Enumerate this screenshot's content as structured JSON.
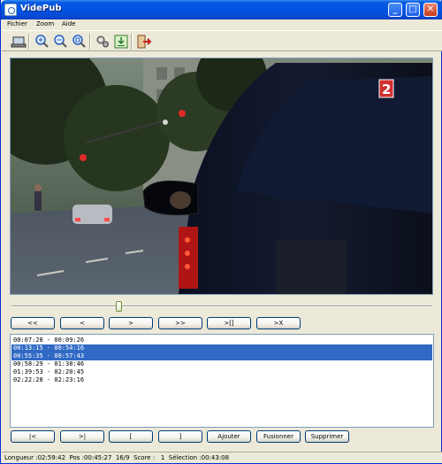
{
  "window": {
    "title": "VidePub"
  },
  "menu": {
    "items": [
      "Fichier",
      "Zoom",
      "Aide"
    ]
  },
  "toolbar": {
    "icons": [
      "screen-capture",
      "zoom-in",
      "zoom-out",
      "zoom-fit",
      "settings",
      "export",
      "exit"
    ]
  },
  "video": {
    "channel_logo": "2"
  },
  "slider": {
    "position": 0.255
  },
  "nav_buttons": [
    "<<",
    "<",
    ">",
    ">>",
    ">[]",
    ">X"
  ],
  "list": {
    "items": [
      "00:07:28 - 00:09:26",
      "00:13:15 - 00:54:16",
      "00:55:35 - 00:57:43",
      "00:58:29 - 01:38:46",
      "01:39:53 - 02:20:45",
      "02:22:28 - 02:23:16"
    ],
    "selected": [
      1,
      2
    ]
  },
  "edit_buttons": [
    "|<",
    ">|",
    "[",
    "]",
    "Ajouter",
    "Fusionner",
    "Supprimer"
  ],
  "status": {
    "text": "Longueur :02:59:42  Pos :00:45:27  16/9  Score :   1  Sélection :00:43:08"
  },
  "colors": {
    "selection": "#316ac5",
    "titlebar": "#0054e3"
  }
}
